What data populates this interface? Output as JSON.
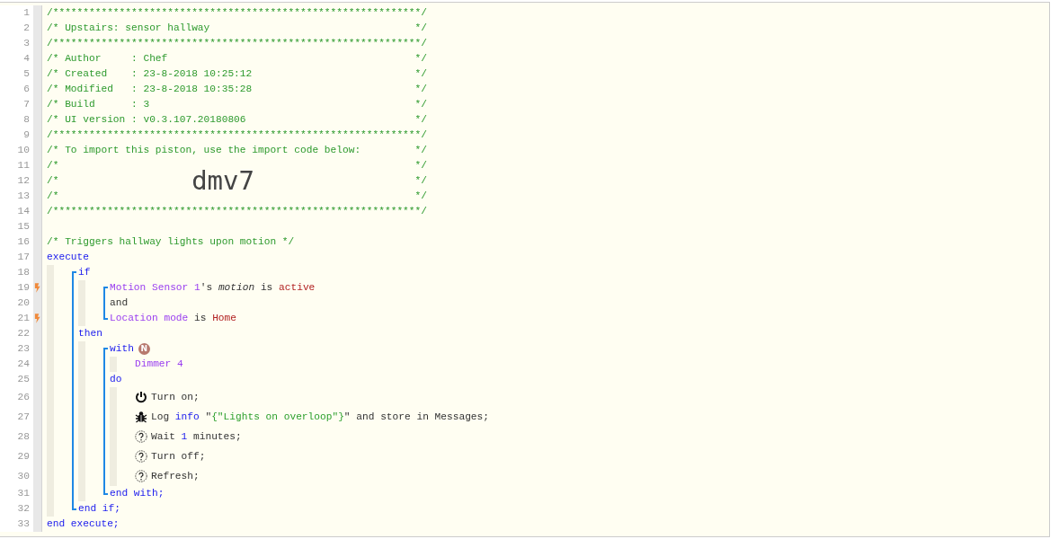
{
  "editor": {
    "lines": [
      {
        "kind": "line",
        "number": "1",
        "trigger": false,
        "tokens": [
          {
            "kind": "comment",
            "text": "/*************************************************************/"
          }
        ]
      },
      {
        "kind": "line",
        "number": "2",
        "trigger": false,
        "tokens": [
          {
            "kind": "comment",
            "text": "/* Upstairs: sensor hallway                                  */"
          }
        ]
      },
      {
        "kind": "line",
        "number": "3",
        "trigger": false,
        "tokens": [
          {
            "kind": "comment",
            "text": "/*************************************************************/"
          }
        ]
      },
      {
        "kind": "line",
        "number": "4",
        "trigger": false,
        "tokens": [
          {
            "kind": "comment",
            "text": "/* Author     : Chef                                         */"
          }
        ]
      },
      {
        "kind": "line",
        "number": "5",
        "trigger": false,
        "tokens": [
          {
            "kind": "comment",
            "text": "/* Created    : 23-8-2018 10:25:12                           */"
          }
        ]
      },
      {
        "kind": "line",
        "number": "6",
        "trigger": false,
        "tokens": [
          {
            "kind": "comment",
            "text": "/* Modified   : 23-8-2018 10:35:28                           */"
          }
        ]
      },
      {
        "kind": "line",
        "number": "7",
        "trigger": false,
        "tokens": [
          {
            "kind": "comment",
            "text": "/* Build      : 3                                            */"
          }
        ]
      },
      {
        "kind": "line",
        "number": "8",
        "trigger": false,
        "tokens": [
          {
            "kind": "comment",
            "text": "/* UI version : v0.3.107.20180806                            */"
          }
        ]
      },
      {
        "kind": "line",
        "number": "9",
        "trigger": false,
        "tokens": [
          {
            "kind": "comment",
            "text": "/*************************************************************/"
          }
        ]
      },
      {
        "kind": "line",
        "number": "10",
        "trigger": false,
        "tokens": [
          {
            "kind": "comment",
            "text": "/* To import this piston, use the import code below:         */"
          }
        ]
      },
      {
        "kind": "line",
        "number": "11",
        "trigger": false,
        "tokens": [
          {
            "kind": "comment",
            "text": "/*                                                           */"
          }
        ]
      },
      {
        "kind": "line",
        "number": "12",
        "trigger": false,
        "tokens": [
          {
            "kind": "comment",
            "text": "/*                      "
          },
          {
            "kind": "import_code",
            "text": "dmv7"
          },
          {
            "kind": "comment_end",
            "text": "          */"
          }
        ]
      },
      {
        "kind": "line",
        "number": "13",
        "trigger": false,
        "tokens": [
          {
            "kind": "comment",
            "text": "/*                                                           */"
          }
        ]
      },
      {
        "kind": "line",
        "number": "14",
        "trigger": false,
        "tokens": [
          {
            "kind": "comment",
            "text": "/*************************************************************/"
          }
        ]
      },
      {
        "kind": "line",
        "number": "15",
        "trigger": false
      },
      {
        "kind": "line",
        "number": "16",
        "trigger": false,
        "tokens": [
          {
            "kind": "comment",
            "text": "/* Triggers hallway lights upon motion */"
          }
        ]
      },
      {
        "kind": "line",
        "number": "17",
        "trigger": false,
        "tokens": [
          {
            "kind": "keyword",
            "text": "execute"
          }
        ]
      },
      {
        "kind": "block",
        "children": [
          {
            "kind": "bracket",
            "children": [
              {
                "kind": "line",
                "number": "18",
                "trigger": false,
                "tokens": [
                  {
                    "kind": "keyword",
                    "text": "if"
                  }
                ]
              },
              {
                "kind": "block",
                "children": [
                  {
                    "kind": "bracket",
                    "children": [
                      {
                        "kind": "line",
                        "number": "19",
                        "trigger": true,
                        "tokens": [
                          {
                            "kind": "device",
                            "text": "Motion Sensor 1"
                          },
                          {
                            "kind": "text",
                            "text": "'s "
                          },
                          {
                            "kind": "italic",
                            "text": "motion"
                          },
                          {
                            "kind": "text",
                            "text": " is "
                          },
                          {
                            "kind": "value",
                            "text": "active"
                          }
                        ]
                      },
                      {
                        "kind": "line",
                        "number": "20",
                        "trigger": false,
                        "tokens": [
                          {
                            "kind": "text",
                            "text": "and"
                          }
                        ]
                      },
                      {
                        "kind": "line",
                        "number": "21",
                        "trigger": true,
                        "tokens": [
                          {
                            "kind": "device",
                            "text": "Location mode"
                          },
                          {
                            "kind": "text",
                            "text": " is "
                          },
                          {
                            "kind": "value",
                            "text": "Home"
                          }
                        ]
                      }
                    ]
                  }
                ]
              },
              {
                "kind": "line",
                "number": "22",
                "trigger": false,
                "tokens": [
                  {
                    "kind": "keyword",
                    "text": "then"
                  }
                ]
              },
              {
                "kind": "block",
                "children": [
                  {
                    "kind": "bracket",
                    "children": [
                      {
                        "kind": "line",
                        "number": "23",
                        "trigger": false,
                        "tokens": [
                          {
                            "kind": "keyword",
                            "text": "with"
                          },
                          {
                            "kind": "badge",
                            "text": "N"
                          }
                        ]
                      },
                      {
                        "kind": "block",
                        "children": [
                          {
                            "kind": "line",
                            "number": "24",
                            "trigger": false,
                            "tokens": [
                              {
                                "kind": "device",
                                "text": "Dimmer 4"
                              }
                            ]
                          }
                        ]
                      },
                      {
                        "kind": "line",
                        "number": "25",
                        "trigger": false,
                        "tokens": [
                          {
                            "kind": "keyword",
                            "text": "do"
                          }
                        ]
                      },
                      {
                        "kind": "block",
                        "children": [
                          {
                            "kind": "power",
                            "number": "26",
                            "trigger": false,
                            "tokens": [
                              {
                                "kind": "text",
                                "text": "Turn on;"
                              }
                            ]
                          },
                          {
                            "kind": "bug",
                            "number": "27",
                            "trigger": false,
                            "tokens": [
                              {
                                "kind": "text",
                                "text": "Log "
                              },
                              {
                                "kind": "keyword",
                                "text": "info"
                              },
                              {
                                "kind": "text",
                                "text": " \""
                              },
                              {
                                "kind": "string",
                                "text": "{\"Lights on overloop\"}"
                              },
                              {
                                "kind": "text",
                                "text": "\" and store in Messages;"
                              }
                            ]
                          },
                          {
                            "kind": "help",
                            "number": "28",
                            "trigger": false,
                            "tokens": [
                              {
                                "kind": "text",
                                "text": "Wait "
                              },
                              {
                                "kind": "number",
                                "text": "1"
                              },
                              {
                                "kind": "text",
                                "text": " minutes;"
                              }
                            ]
                          },
                          {
                            "kind": "help",
                            "number": "29",
                            "trigger": false,
                            "tokens": [
                              {
                                "kind": "text",
                                "text": "Turn off;"
                              }
                            ]
                          },
                          {
                            "kind": "help",
                            "number": "30",
                            "trigger": false,
                            "tokens": [
                              {
                                "kind": "text",
                                "text": "Refresh;"
                              }
                            ]
                          }
                        ]
                      },
                      {
                        "kind": "line",
                        "number": "31",
                        "trigger": false,
                        "tokens": [
                          {
                            "kind": "keyword",
                            "text": "end with;"
                          }
                        ]
                      }
                    ]
                  }
                ]
              },
              {
                "kind": "line",
                "number": "32",
                "trigger": false,
                "tokens": [
                  {
                    "kind": "keyword",
                    "text": "end if;"
                  }
                ]
              }
            ]
          }
        ]
      },
      {
        "kind": "line",
        "number": "33",
        "trigger": false,
        "tokens": [
          {
            "kind": "keyword",
            "text": "end execute;"
          }
        ]
      }
    ]
  }
}
